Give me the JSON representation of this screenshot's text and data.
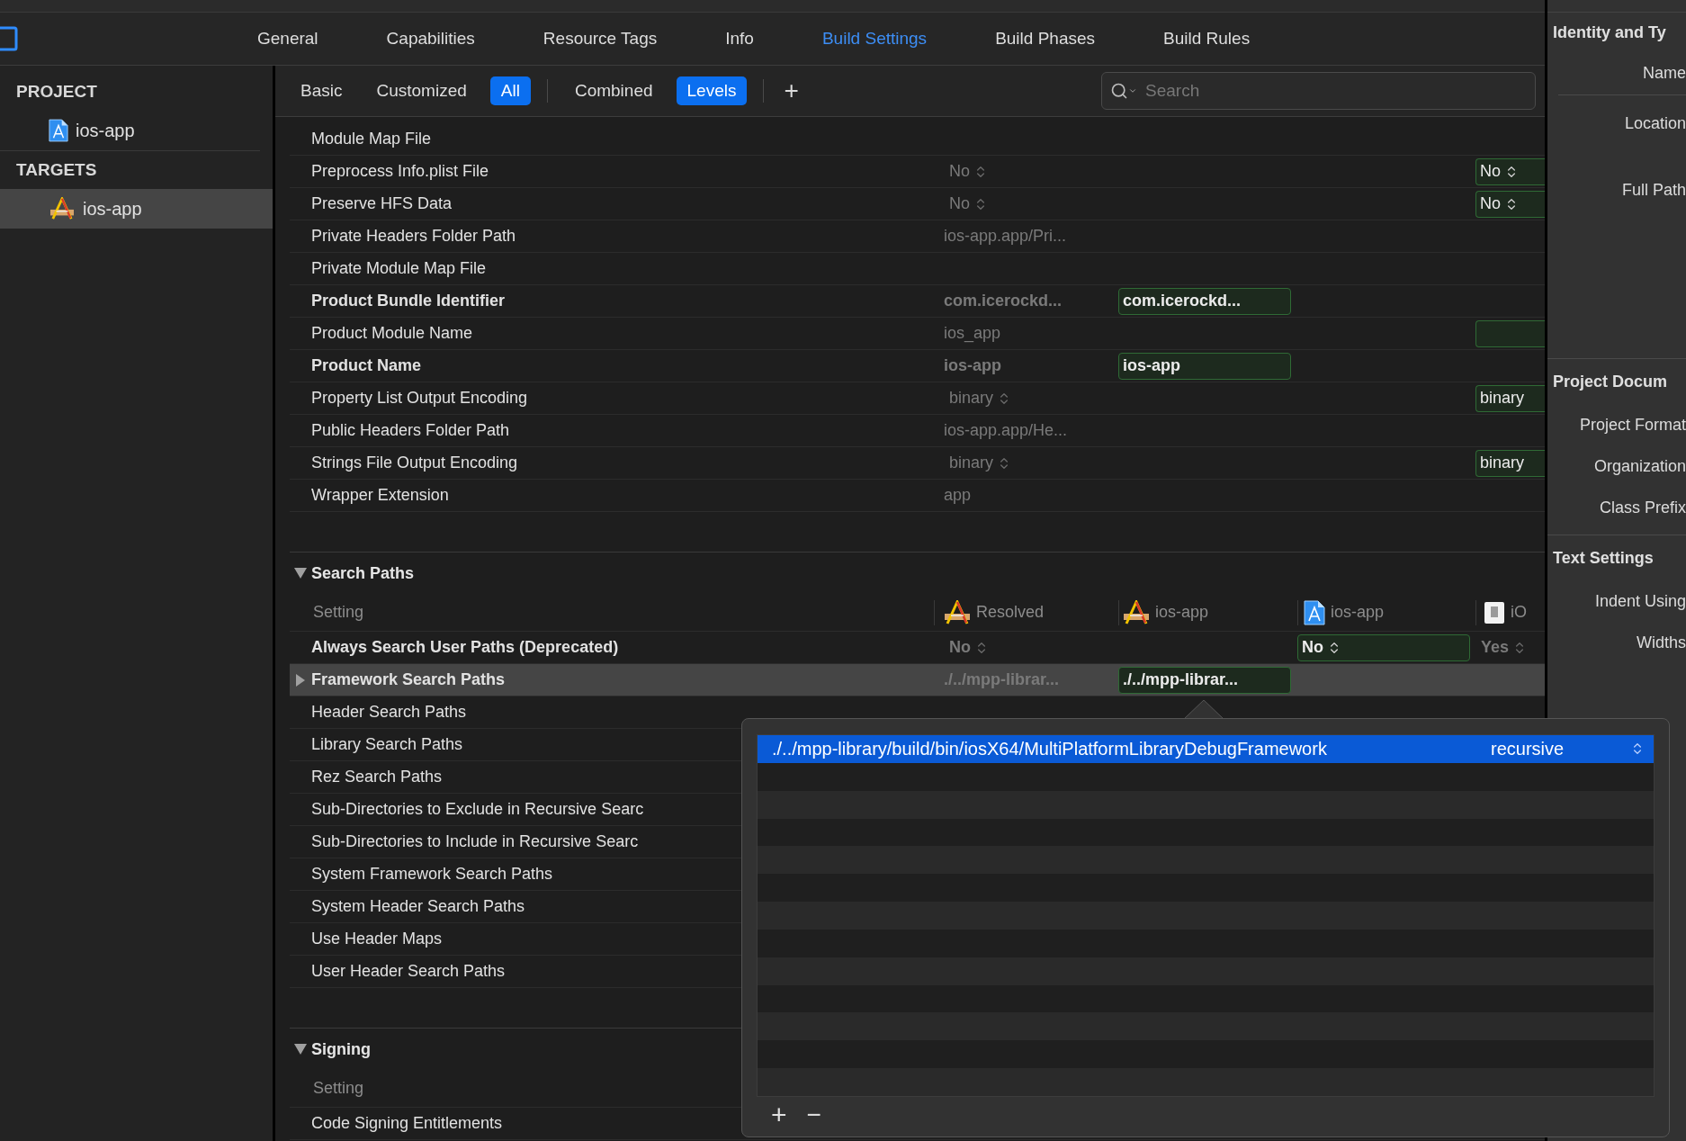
{
  "top_tabs": [
    {
      "label": "General",
      "selected": false
    },
    {
      "label": "Capabilities",
      "selected": false
    },
    {
      "label": "Resource Tags",
      "selected": false
    },
    {
      "label": "Info",
      "selected": false
    },
    {
      "label": "Build Settings",
      "selected": true
    },
    {
      "label": "Build Phases",
      "selected": false
    },
    {
      "label": "Build Rules",
      "selected": false
    }
  ],
  "sidebar": {
    "sections": [
      {
        "title": "PROJECT",
        "items": [
          {
            "label": "ios-app",
            "kind": "project",
            "selected": false
          }
        ]
      },
      {
        "title": "TARGETS",
        "items": [
          {
            "label": "ios-app",
            "kind": "target",
            "selected": true
          }
        ]
      }
    ]
  },
  "filter_bar": {
    "groups": [
      [
        {
          "label": "Basic",
          "selected": false
        },
        {
          "label": "Customized",
          "selected": false
        },
        {
          "label": "All",
          "selected": true
        }
      ],
      [
        {
          "label": "Combined",
          "selected": false
        },
        {
          "label": "Levels",
          "selected": true
        }
      ]
    ],
    "add_label": "+",
    "search": {
      "placeholder": "Search"
    }
  },
  "sections": [
    {
      "rows": [
        {
          "label": "Module Map File",
          "bold": false,
          "selected": false,
          "cells": {}
        },
        {
          "label": "Preprocess Info.plist File",
          "bold": false,
          "selected": false,
          "cells": {
            "resolved": {
              "text": "No",
              "kind": "popup",
              "boxed": false
            },
            "default": {
              "text": "No",
              "kind": "popup",
              "boxed": true
            }
          }
        },
        {
          "label": "Preserve HFS Data",
          "bold": false,
          "selected": false,
          "cells": {
            "resolved": {
              "text": "No",
              "kind": "popup",
              "boxed": false
            },
            "default": {
              "text": "No",
              "kind": "popup",
              "boxed": true
            }
          }
        },
        {
          "label": "Private Headers Folder Path",
          "bold": false,
          "selected": false,
          "cells": {
            "resolved": {
              "text": "ios-app.app/Pri...",
              "kind": "text",
              "boxed": false
            }
          }
        },
        {
          "label": "Private Module Map File",
          "bold": false,
          "selected": false,
          "cells": {}
        },
        {
          "label": "Product Bundle Identifier",
          "bold": true,
          "selected": false,
          "cells": {
            "resolved": {
              "text": "com.icerockd...",
              "kind": "text",
              "boxed": false
            },
            "target": {
              "text": "com.icerockd...",
              "kind": "text",
              "boxed": true
            }
          }
        },
        {
          "label": "Product Module Name",
          "bold": false,
          "selected": false,
          "cells": {
            "resolved": {
              "text": "ios_app",
              "kind": "text",
              "boxed": false
            },
            "default": {
              "kind": "text",
              "boxed": true
            }
          }
        },
        {
          "label": "Product Name",
          "bold": true,
          "selected": false,
          "cells": {
            "resolved": {
              "text": "ios-app",
              "kind": "text",
              "boxed": false
            },
            "target": {
              "text": "ios-app",
              "kind": "text",
              "boxed": true
            }
          }
        },
        {
          "label": "Property List Output Encoding",
          "bold": false,
          "selected": false,
          "cells": {
            "resolved": {
              "text": "binary",
              "kind": "popup",
              "boxed": false
            },
            "default": {
              "text": "binary",
              "kind": "text",
              "boxed": true
            }
          }
        },
        {
          "label": "Public Headers Folder Path",
          "bold": false,
          "selected": false,
          "cells": {
            "resolved": {
              "text": "ios-app.app/He...",
              "kind": "text",
              "boxed": false
            }
          }
        },
        {
          "label": "Strings File Output Encoding",
          "bold": false,
          "selected": false,
          "cells": {
            "resolved": {
              "text": "binary",
              "kind": "popup",
              "boxed": false
            },
            "default": {
              "text": "binary",
              "kind": "text",
              "boxed": true
            }
          }
        },
        {
          "label": "Wrapper Extension",
          "bold": false,
          "selected": false,
          "cells": {
            "resolved": {
              "text": "app",
              "kind": "text",
              "boxed": false
            }
          }
        }
      ]
    },
    {
      "title": "Search Paths",
      "expanded": true,
      "columns": [
        {
          "label": "Setting",
          "kind": "plain"
        },
        {
          "label": "Resolved",
          "kind": "target"
        },
        {
          "label": "ios-app",
          "kind": "target"
        },
        {
          "label": "ios-app",
          "kind": "project"
        },
        {
          "label": "iO",
          "kind": "platform"
        }
      ],
      "rows": [
        {
          "label": "Always Search User Paths (Deprecated)",
          "bold": true,
          "selected": false,
          "cells": {
            "resolved": {
              "text": "No",
              "kind": "popup",
              "boxed": false
            },
            "project": {
              "text": "No",
              "kind": "popup",
              "boxed": true
            },
            "default": {
              "text": "Yes",
              "kind": "popup",
              "boxed": false
            }
          }
        },
        {
          "label": "Framework Search Paths",
          "bold": true,
          "selected": true,
          "expanded": false,
          "cells": {
            "resolved": {
              "text": "./../mpp-librar...",
              "kind": "text",
              "boxed": false
            },
            "target": {
              "text": "./../mpp-librar...",
              "kind": "text",
              "boxed": true
            }
          }
        },
        {
          "label": "Header Search Paths",
          "bold": false,
          "selected": false,
          "cells": {}
        },
        {
          "label": "Library Search Paths",
          "bold": false,
          "selected": false,
          "cells": {}
        },
        {
          "label": "Rez Search Paths",
          "bold": false,
          "selected": false,
          "cells": {}
        },
        {
          "label": "Sub-Directories to Exclude in Recursive Searc",
          "bold": false,
          "selected": false,
          "cells": {}
        },
        {
          "label": "Sub-Directories to Include in Recursive Searc",
          "bold": false,
          "selected": false,
          "cells": {}
        },
        {
          "label": "System Framework Search Paths",
          "bold": false,
          "selected": false,
          "cells": {}
        },
        {
          "label": "System Header Search Paths",
          "bold": false,
          "selected": false,
          "cells": {}
        },
        {
          "label": "Use Header Maps",
          "bold": false,
          "selected": false,
          "cells": {}
        },
        {
          "label": "User Header Search Paths",
          "bold": false,
          "selected": false,
          "cells": {}
        }
      ]
    },
    {
      "title": "Signing",
      "expanded": true,
      "columns": [
        {
          "label": "Setting",
          "kind": "plain"
        }
      ],
      "rows": [
        {
          "label": "Code Signing Entitlements",
          "bold": false,
          "selected": false,
          "cells": {}
        }
      ]
    }
  ],
  "popover": {
    "entries": [
      {
        "path": "./../mpp-library/build/bin/iosX64/MultiPlatformLibraryDebugFramework",
        "mode": "recursive",
        "selected": true
      }
    ],
    "add_label": "+",
    "remove_label": "−"
  },
  "inspector": {
    "groups": [
      {
        "title": "Identity and Ty",
        "fields": [
          "Name",
          "Location",
          "Full Path"
        ]
      },
      {
        "title": "Project Docum",
        "fields": [
          "Project Format",
          "Organization",
          "Class Prefix"
        ]
      },
      {
        "title": "Text Settings",
        "fields": [
          "Indent Using",
          "Widths"
        ]
      }
    ]
  }
}
